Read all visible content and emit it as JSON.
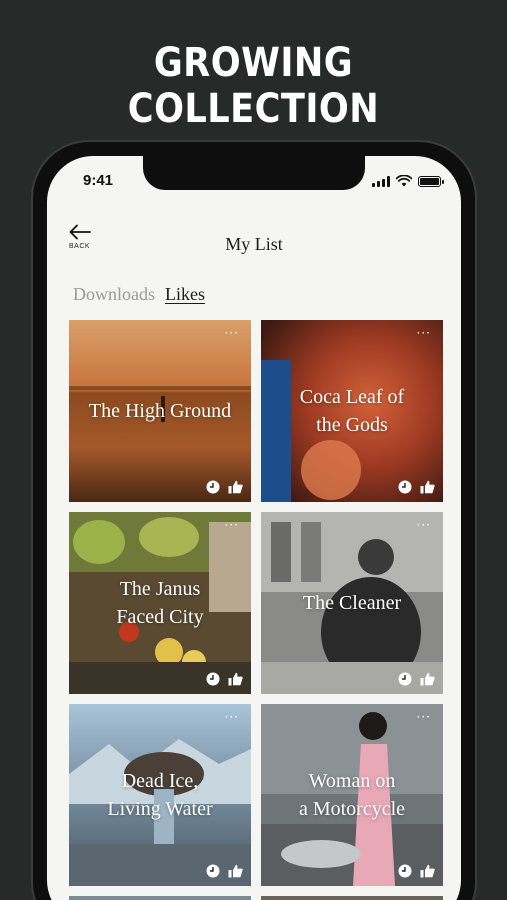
{
  "headline": "GROWING COLLECTION",
  "status_bar": {
    "time": "9:41"
  },
  "nav": {
    "back_label": "BACK",
    "title": "My List"
  },
  "tabs": [
    {
      "label": "Downloads",
      "active": false
    },
    {
      "label": "Likes",
      "active": true
    }
  ],
  "cards": [
    {
      "title": "The High Ground",
      "menu": "···"
    },
    {
      "title": "Coca Leaf of\nthe Gods",
      "menu": "···"
    },
    {
      "title": "The Janus\nFaced City",
      "menu": "···"
    },
    {
      "title": "The Cleaner",
      "menu": "···"
    },
    {
      "title": "Dead Ice,\nLiving Water",
      "menu": "···"
    },
    {
      "title": "Woman on\na Motorcycle",
      "menu": "···"
    }
  ],
  "icons": {
    "back": "arrow-left-icon",
    "watch_later": "clock-icon",
    "like": "thumbs-up-icon",
    "more": "more-dots-icon"
  },
  "colors": {
    "background": "#262a29",
    "screen": "#f5f5f3",
    "active_tab": "#1c1c1c",
    "inactive_tab": "#9a9a9a"
  }
}
